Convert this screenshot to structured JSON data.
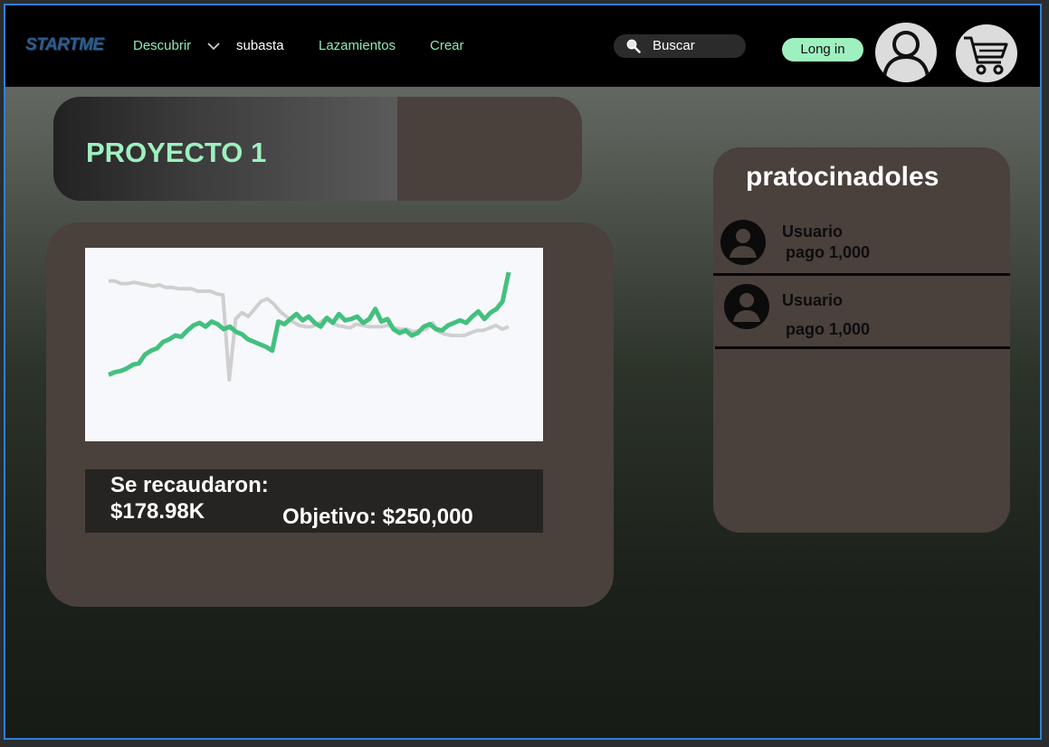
{
  "nav": {
    "logo": "STARTME",
    "links": [
      "Descubrir",
      "subasta",
      "Lazamientos",
      "Crear"
    ],
    "search_label": "Buscar",
    "login_label": "Long in"
  },
  "project": {
    "title": "PROYECTO 1",
    "funds_label": "Se recaudaron:",
    "funds_amount": "$178.98K",
    "goal_label": "Objetivo: $250,000"
  },
  "sponsors": {
    "title": "pratocinadoles",
    "items": [
      {
        "name": "Usuario",
        "payment": "pago 1,000"
      },
      {
        "name": "Usuario",
        "payment": "pago 1,000"
      }
    ]
  },
  "colors": {
    "accent": "#9ef0bf",
    "card": "#4a403c",
    "chart_green": "#43c07f",
    "chart_gray": "#cfcfcf"
  },
  "chart_data": {
    "type": "line",
    "title": "",
    "xlabel": "",
    "ylabel": "",
    "grid": false,
    "ylim": [
      0,
      100
    ],
    "series": [
      {
        "values": [
          88,
          88,
          86,
          86,
          87,
          86,
          85,
          84,
          85,
          83,
          83,
          82,
          82,
          82,
          80,
          80,
          80,
          78,
          77,
          10,
          58,
          63,
          60,
          66,
          72,
          74,
          70,
          64,
          60,
          56,
          53,
          52,
          52,
          54,
          58,
          56,
          53,
          52,
          51,
          54,
          53,
          52,
          52,
          52,
          53,
          51,
          50,
          50,
          48,
          49,
          50,
          55,
          48,
          46,
          45,
          45,
          45,
          47,
          49,
          49,
          51,
          53,
          50,
          52
        ]
      },
      {
        "values": [
          14,
          16,
          17,
          19,
          22,
          23,
          30,
          33,
          35,
          40,
          42,
          45,
          44,
          49,
          53,
          55,
          52,
          56,
          54,
          50,
          52,
          48,
          46,
          42,
          40,
          38,
          36,
          33,
          56,
          54,
          58,
          62,
          57,
          60,
          55,
          52,
          59,
          55,
          62,
          57,
          58,
          60,
          55,
          58,
          66,
          56,
          58,
          50,
          47,
          49,
          45,
          47,
          52,
          54,
          50,
          49,
          53,
          55,
          57,
          55,
          60,
          64,
          58,
          63,
          66,
          72,
          95
        ]
      }
    ]
  }
}
